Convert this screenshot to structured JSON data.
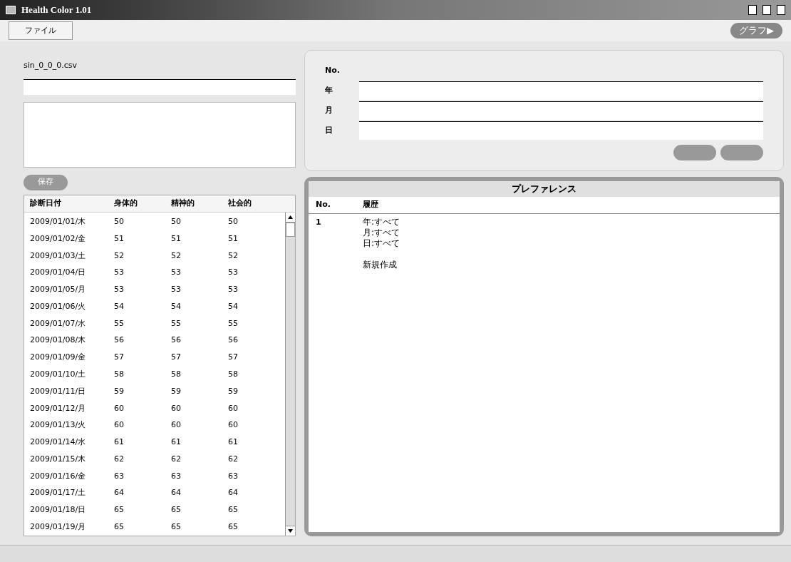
{
  "window": {
    "title": "Health Color 1.01"
  },
  "menu": [
    "ファイル"
  ],
  "graph_button": "グラフ▶",
  "file": {
    "name": "sin_0_0_0.csv"
  },
  "save_button": "保存",
  "table": {
    "columns": [
      "診断日付",
      "身体的",
      "精神的",
      "社会的"
    ],
    "rows": [
      [
        "2009/01/01/木",
        "50",
        "50",
        "50"
      ],
      [
        "2009/01/02/金",
        "51",
        "51",
        "51"
      ],
      [
        "2009/01/03/土",
        "52",
        "52",
        "52"
      ],
      [
        "2009/01/04/日",
        "53",
        "53",
        "53"
      ],
      [
        "2009/01/05/月",
        "53",
        "53",
        "53"
      ],
      [
        "2009/01/06/火",
        "54",
        "54",
        "54"
      ],
      [
        "2009/01/07/水",
        "55",
        "55",
        "55"
      ],
      [
        "2009/01/08/木",
        "56",
        "56",
        "56"
      ],
      [
        "2009/01/09/金",
        "57",
        "57",
        "57"
      ],
      [
        "2009/01/10/土",
        "58",
        "58",
        "58"
      ],
      [
        "2009/01/11/日",
        "59",
        "59",
        "59"
      ],
      [
        "2009/01/12/月",
        "60",
        "60",
        "60"
      ],
      [
        "2009/01/13/火",
        "60",
        "60",
        "60"
      ],
      [
        "2009/01/14/水",
        "61",
        "61",
        "61"
      ],
      [
        "2009/01/15/木",
        "62",
        "62",
        "62"
      ],
      [
        "2009/01/16/金",
        "63",
        "63",
        "63"
      ],
      [
        "2009/01/17/土",
        "64",
        "64",
        "64"
      ],
      [
        "2009/01/18/日",
        "65",
        "65",
        "65"
      ],
      [
        "2009/01/19/月",
        "65",
        "65",
        "65"
      ]
    ]
  },
  "form": {
    "labels": [
      "No.",
      "年",
      "月",
      "日"
    ]
  },
  "preferences": {
    "title": "プレファレンス",
    "columns": [
      "No.",
      "履歴"
    ],
    "rows": [
      {
        "no": "1",
        "lines": [
          "年:すべて",
          "月:すべて",
          "日:すべて"
        ],
        "note": "新規作成"
      }
    ]
  }
}
